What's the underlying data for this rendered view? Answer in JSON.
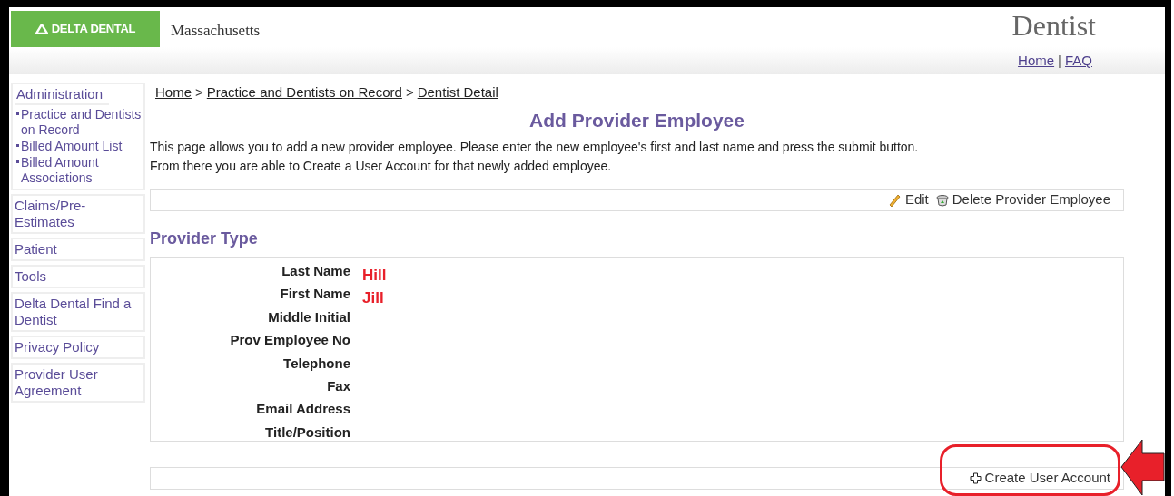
{
  "header": {
    "logo_text": "DELTA DENTAL",
    "region": "Massachusetts",
    "portal": "Dentist",
    "links": [
      "Home",
      "FAQ"
    ],
    "link_separator": "|"
  },
  "breadcrumb": {
    "items": [
      "Home",
      "Practice and Dentists on Record",
      "Dentist Detail"
    ],
    "separator": ">"
  },
  "sidebar": {
    "items": [
      {
        "label": "Administration",
        "children": [
          {
            "label": "Practice and Dentists on Record"
          },
          {
            "label": "Billed Amount List"
          },
          {
            "label": "Billed Amount Associations"
          }
        ]
      },
      {
        "label": "Claims/Pre-Estimates"
      },
      {
        "label": "Patient"
      },
      {
        "label": "Tools"
      },
      {
        "label": "Delta Dental Find a Dentist"
      },
      {
        "label": "Privacy Policy"
      },
      {
        "label": "Provider User Agreement"
      }
    ]
  },
  "page_title": "Add Provider Employee",
  "description": [
    "This page allows you to add a new provider employee. Please enter the new employee's first and last name and press the submit button.",
    "From there you are able to Create a User Account for that newly added employee."
  ],
  "actions": [
    {
      "kind": "edit",
      "label": "Edit"
    },
    {
      "kind": "delete",
      "label": "Delete Provider Employee"
    }
  ],
  "section_title": "Provider Type",
  "fields": [
    {
      "label": "Last Name",
      "value": "Hill"
    },
    {
      "label": "First Name",
      "value": "Jill"
    },
    {
      "label": "Middle Initial"
    },
    {
      "label": "Prov Employee No"
    },
    {
      "label": "Telephone"
    },
    {
      "label": "Fax"
    },
    {
      "label": "Email Address"
    },
    {
      "label": "Title/Position"
    }
  ],
  "create_action": {
    "label": "Create User Account",
    "highlighted": true
  }
}
